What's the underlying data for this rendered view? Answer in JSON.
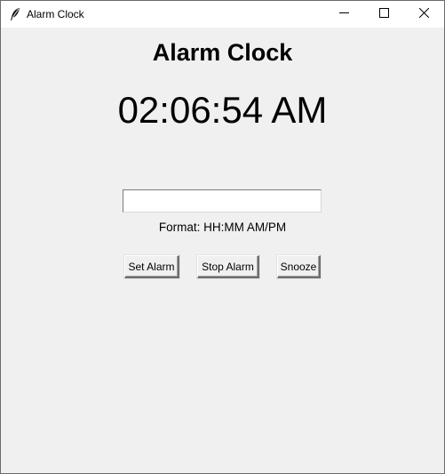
{
  "window": {
    "title": "Alarm Clock",
    "icons": {
      "app": "feather-icon",
      "minimize": "minimize-icon",
      "maximize": "maximize-icon",
      "close": "close-icon"
    }
  },
  "main": {
    "heading": "Alarm Clock",
    "current_time": "02:06:54 AM",
    "alarm_input": {
      "value": "",
      "placeholder": ""
    },
    "format_hint": "Format: HH:MM AM/PM",
    "buttons": {
      "set_alarm": "Set Alarm",
      "stop_alarm": "Stop Alarm",
      "snooze": "Snooze"
    }
  },
  "colors": {
    "background": "#f0f0f0",
    "titlebar": "#ffffff",
    "text": "#000000"
  }
}
